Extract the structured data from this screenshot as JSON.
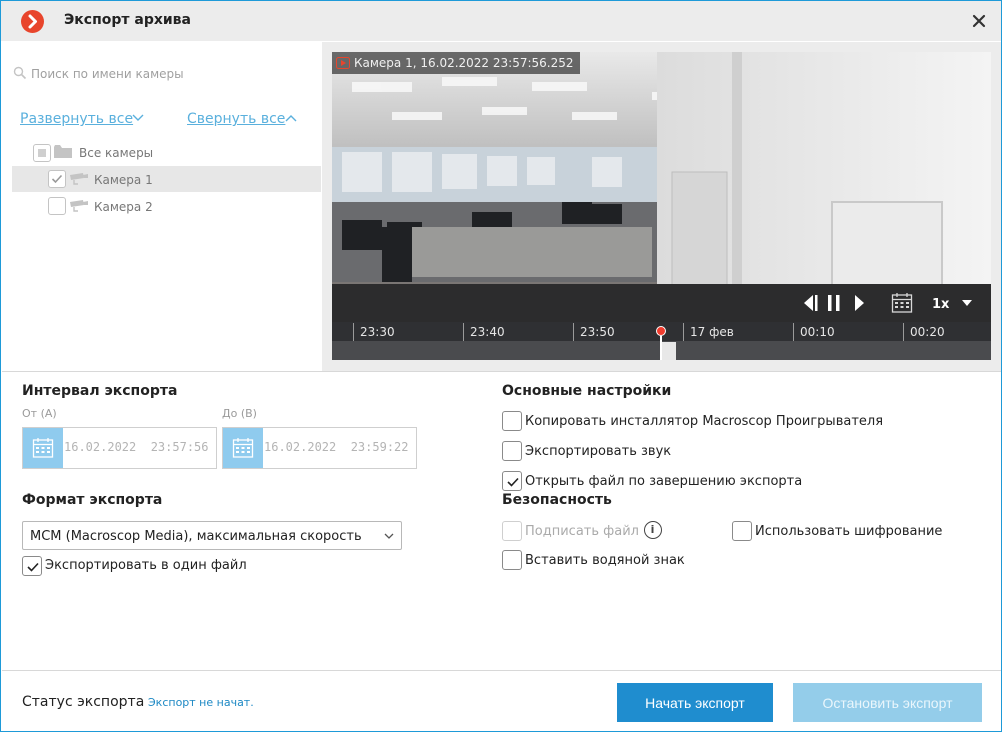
{
  "window": {
    "title": "Экспорт архива",
    "accent": "#1e9ad8",
    "logo_color": "#e8452c"
  },
  "tree": {
    "search_placeholder": "Поиск по имени камеры",
    "expand_all": "Развернуть все",
    "collapse_all": "Свернуть все",
    "root": {
      "label": "Все камеры",
      "checked": "partial"
    },
    "cameras": [
      {
        "label": "Камера 1",
        "checked": true,
        "selected": true
      },
      {
        "label": "Камера 2",
        "checked": false,
        "selected": false
      }
    ]
  },
  "player": {
    "overlay": "Камера 1, 16.02.2022 23:57:56.252",
    "speed": "1x",
    "timeline_labels": [
      "23:30",
      "23:40",
      "23:50",
      "17 фев",
      "00:10",
      "00:20"
    ]
  },
  "interval": {
    "title": "Интервал экспорта",
    "from_label": "От (А)",
    "from_value": "16.02.2022  23:57:56",
    "to_label": "До (В)",
    "to_value": "16.02.2022  23:59:22"
  },
  "format": {
    "title": "Формат экспорта",
    "selected": "MCM (Macroscop Media), максимальная скорость",
    "single_file": {
      "label": "Экспортировать в один файл",
      "checked": true
    }
  },
  "settings": {
    "title": "Основные настройки",
    "copy_installer": {
      "label": "Копировать инсталлятор Macroscop Проигрывателя",
      "checked": false
    },
    "export_audio": {
      "label": "Экспортировать звук",
      "checked": false
    },
    "open_file": {
      "label": "Открыть файл по завершению экспорта",
      "checked": true
    }
  },
  "security": {
    "title": "Безопасность",
    "sign_file": {
      "label": "Подписать файл",
      "checked": false,
      "disabled": true
    },
    "encryption": {
      "label": "Использовать шифрование",
      "checked": false
    },
    "watermark": {
      "label": "Вставить водяной знак",
      "checked": false
    }
  },
  "footer": {
    "status_label": "Статус экспорта",
    "status_value": "Экспорт не начат.",
    "start_button": "Начать экспорт",
    "stop_button": "Остановить экспорт"
  }
}
